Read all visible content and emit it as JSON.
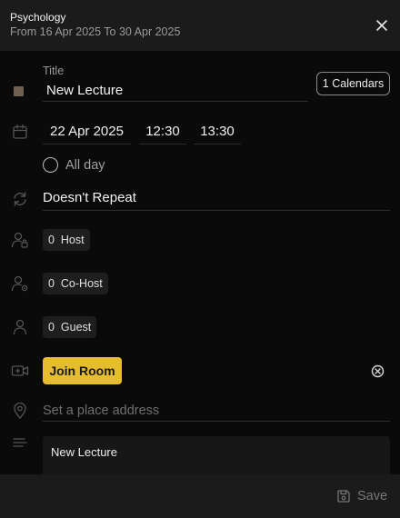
{
  "header": {
    "title": "Psychology",
    "subtitle": "From 16 Apr 2025 To 30 Apr 2025"
  },
  "form": {
    "title_label": "Title",
    "title_value": "New Lecture",
    "calendars_label": "1 Calendars",
    "date": "22 Apr 2025",
    "start_time": "12:30",
    "end_time": "13:30",
    "all_day_label": "All day",
    "repeat_value": "Doesn't Repeat",
    "host": {
      "count": "0",
      "label": "Host"
    },
    "cohost": {
      "count": "0",
      "label": "Co-Host"
    },
    "guest": {
      "count": "0",
      "label": "Guest"
    },
    "join_room_label": "Join Room",
    "address_placeholder": "Set a place address",
    "description_value": "New Lecture"
  },
  "footer": {
    "save_label": "Save"
  },
  "colors": {
    "accent": "#e7bd30",
    "event_color": "#6e6150",
    "background": "#0a0a0a",
    "header_bg": "#1b1b1b"
  },
  "icons": {
    "close": "close-icon",
    "calendar": "calendar-icon",
    "repeat": "repeat-icon",
    "host": "host-icon",
    "cohost": "cohost-icon",
    "guest": "guest-icon",
    "video": "video-icon",
    "location": "location-pin-icon",
    "description": "description-icon",
    "save": "save-icon"
  }
}
